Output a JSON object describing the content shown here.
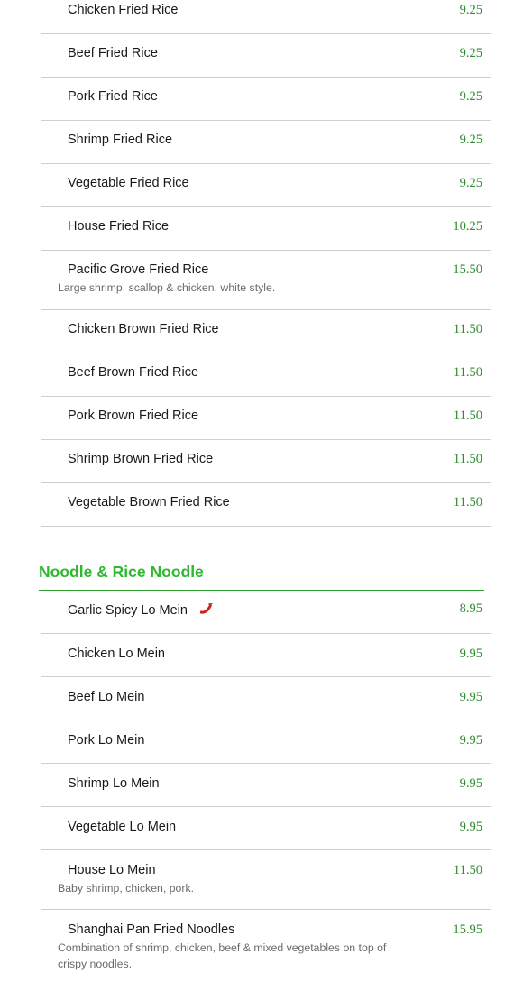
{
  "fried_rice": [
    {
      "name": "Chicken Fried Rice",
      "price": "9.25"
    },
    {
      "name": "Beef Fried Rice",
      "price": "9.25"
    },
    {
      "name": "Pork Fried Rice",
      "price": "9.25"
    },
    {
      "name": "Shrimp Fried Rice",
      "price": "9.25"
    },
    {
      "name": "Vegetable Fried Rice",
      "price": "9.25"
    },
    {
      "name": "House Fried Rice",
      "price": "10.25"
    },
    {
      "name": "Pacific Grove Fried Rice",
      "price": "15.50",
      "desc": "Large shrimp, scallop & chicken, white style."
    },
    {
      "name": "Chicken Brown Fried Rice",
      "price": "11.50"
    },
    {
      "name": "Beef Brown Fried Rice",
      "price": "11.50"
    },
    {
      "name": "Pork Brown Fried Rice",
      "price": "11.50"
    },
    {
      "name": "Shrimp Brown Fried Rice",
      "price": "11.50"
    },
    {
      "name": "Vegetable Brown Fried Rice",
      "price": "11.50"
    }
  ],
  "noodle_section": {
    "title": "Noodle & Rice Noodle",
    "items": [
      {
        "name": "Garlic Spicy Lo Mein",
        "price": "8.95",
        "spicy": true,
        "icon": "chili-pepper-icon"
      },
      {
        "name": "Chicken Lo Mein",
        "price": "9.95"
      },
      {
        "name": "Beef Lo Mein",
        "price": "9.95"
      },
      {
        "name": "Pork Lo Mein",
        "price": "9.95"
      },
      {
        "name": "Shrimp Lo Mein",
        "price": "9.95"
      },
      {
        "name": "Vegetable Lo Mein",
        "price": "9.95"
      },
      {
        "name": "House Lo Mein",
        "price": "11.50",
        "desc": "Baby shrimp, chicken, pork."
      },
      {
        "name": "Shanghai Pan Fried Noodles",
        "price": "15.95",
        "desc": "Combination of shrimp, chicken, beef & mixed vegetables on top of crispy noodles."
      }
    ]
  },
  "colors": {
    "price": "#2e8b2e",
    "section_title": "#2eb82e",
    "divider": "#cfcfcf"
  }
}
